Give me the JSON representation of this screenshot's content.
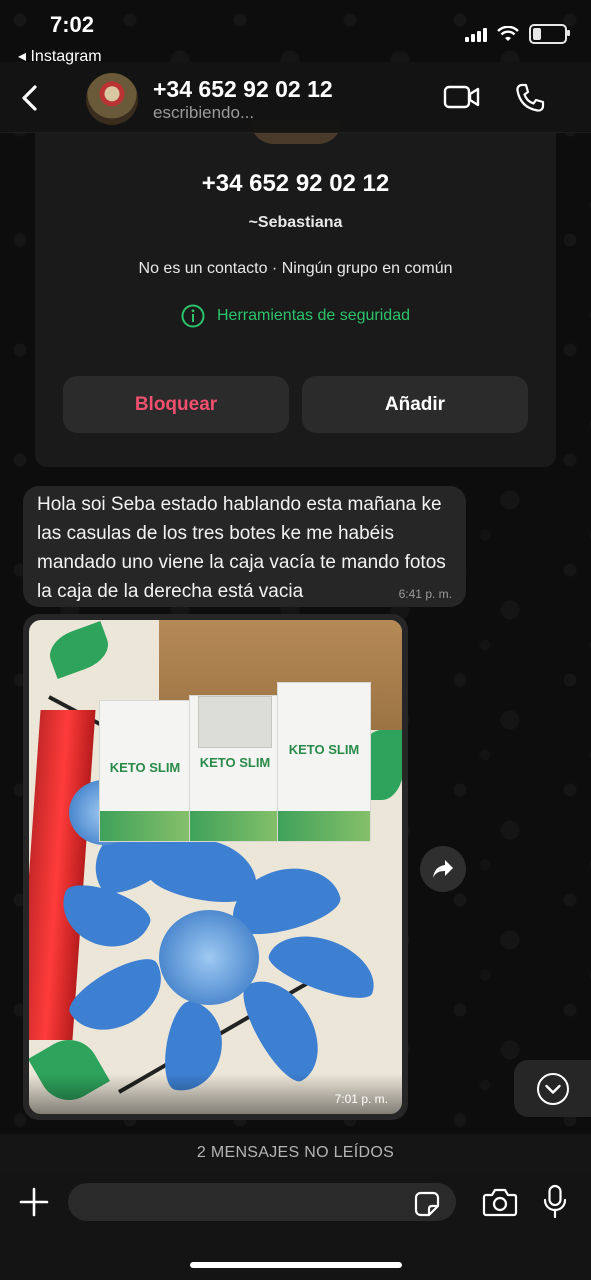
{
  "status_bar": {
    "time": "7:02",
    "back_app": "◂ Instagram"
  },
  "header": {
    "contact_name": "+34 652 92 02 12",
    "status": "escribiendo..."
  },
  "info_card": {
    "phone": "+34 652 92 02 12",
    "push_name": "~Sebastiana",
    "note": "No es un contacto · Ningún grupo en común",
    "security_label": "Herramientas de seguridad",
    "block_label": "Bloquear",
    "add_label": "Añadir"
  },
  "messages": [
    {
      "text": "Hola soi Seba estado hablando esta mañana ke las casulas de los tres botes ke me habéis mandado uno viene la caja vacía te mando fotos la caja de la derecha está vacia",
      "time": "6:41 p. m."
    },
    {
      "type": "photo",
      "box_brand": "KETO SLIM",
      "time": "7:01 p. m."
    }
  ],
  "unread_banner": "2 MENSAJES NO LEÍDOS",
  "composer": {
    "placeholder": ""
  },
  "colors": {
    "accent_green": "#2bc46b",
    "block_red": "#f0506e",
    "bubble": "#262626"
  },
  "icons": [
    "back-chevron-icon",
    "video-call-icon",
    "phone-call-icon",
    "info-circle-icon",
    "share-forward-icon",
    "chevron-down-icon",
    "plus-icon",
    "sticker-icon",
    "camera-icon",
    "microphone-icon"
  ]
}
